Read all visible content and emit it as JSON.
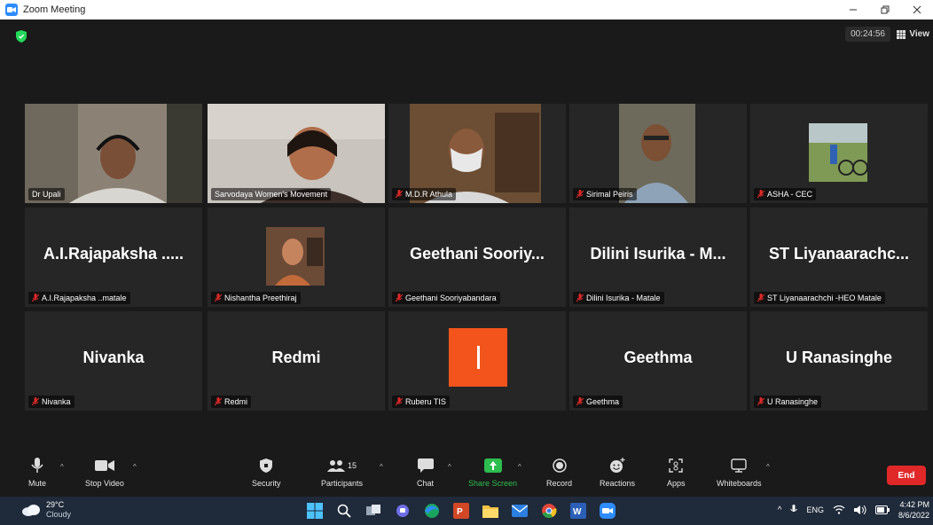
{
  "window": {
    "title": "Zoom Meeting"
  },
  "meeting": {
    "timer": "00:24:56",
    "view_label": "View"
  },
  "tiles": [
    {
      "name": "Dr Upali",
      "active": true,
      "muted": false,
      "display": "video"
    },
    {
      "name": "Sarvodaya Women's Movement",
      "muted": false,
      "display": "video"
    },
    {
      "name": "M.D.R Athula",
      "muted": true,
      "display": "video"
    },
    {
      "name": "Sirimal Peiris",
      "muted": true,
      "display": "video"
    },
    {
      "name": "ASHA - CEC",
      "muted": true,
      "display": "photo"
    },
    {
      "name": "A.I.Rajapaksha ..matale",
      "big": "A.I.Rajapaksha .....",
      "muted": true,
      "display": "name"
    },
    {
      "name": "Nishantha Preethiraj",
      "muted": true,
      "display": "photo"
    },
    {
      "name": "Geethani Sooriyabandara",
      "big": "Geethani Sooriy...",
      "muted": true,
      "display": "name"
    },
    {
      "name": "Dilini Isurika - Matale",
      "big": "Dilini Isurika - M...",
      "muted": true,
      "display": "name"
    },
    {
      "name": "ST Liyanaarachchi -HEO  Matale",
      "big": "ST Liyanaarachc...",
      "muted": true,
      "display": "name"
    },
    {
      "name": "Nivanka",
      "big": "Nivanka",
      "muted": true,
      "display": "name"
    },
    {
      "name": "Redmi",
      "big": "Redmi",
      "muted": true,
      "display": "name"
    },
    {
      "name": "Ruberu TIS",
      "muted": true,
      "display": "initial"
    },
    {
      "name": "Geethma",
      "big": "Geethma",
      "muted": true,
      "display": "name"
    },
    {
      "name": "U Ranasinghe",
      "big": "U Ranasinghe",
      "muted": true,
      "display": "name"
    }
  ],
  "toolbar": {
    "mute": "Mute",
    "stop_video": "Stop Video",
    "security": "Security",
    "participants": "Participants",
    "participants_count": "15",
    "chat": "Chat",
    "share_screen": "Share Screen",
    "record": "Record",
    "reactions": "Reactions",
    "apps": "Apps",
    "whiteboards": "Whiteboards",
    "end": "End"
  },
  "taskbar": {
    "temperature": "29°C",
    "weather": "Cloudy",
    "language": "ENG",
    "time": "4:42 PM",
    "date": "8/6/2022"
  },
  "colors": {
    "active_border": "#e8f36b",
    "share_green": "#2dbd4e",
    "end_red": "#e02828",
    "initial_orange": "#f2541b",
    "zoom_blue": "#2d8cff"
  }
}
